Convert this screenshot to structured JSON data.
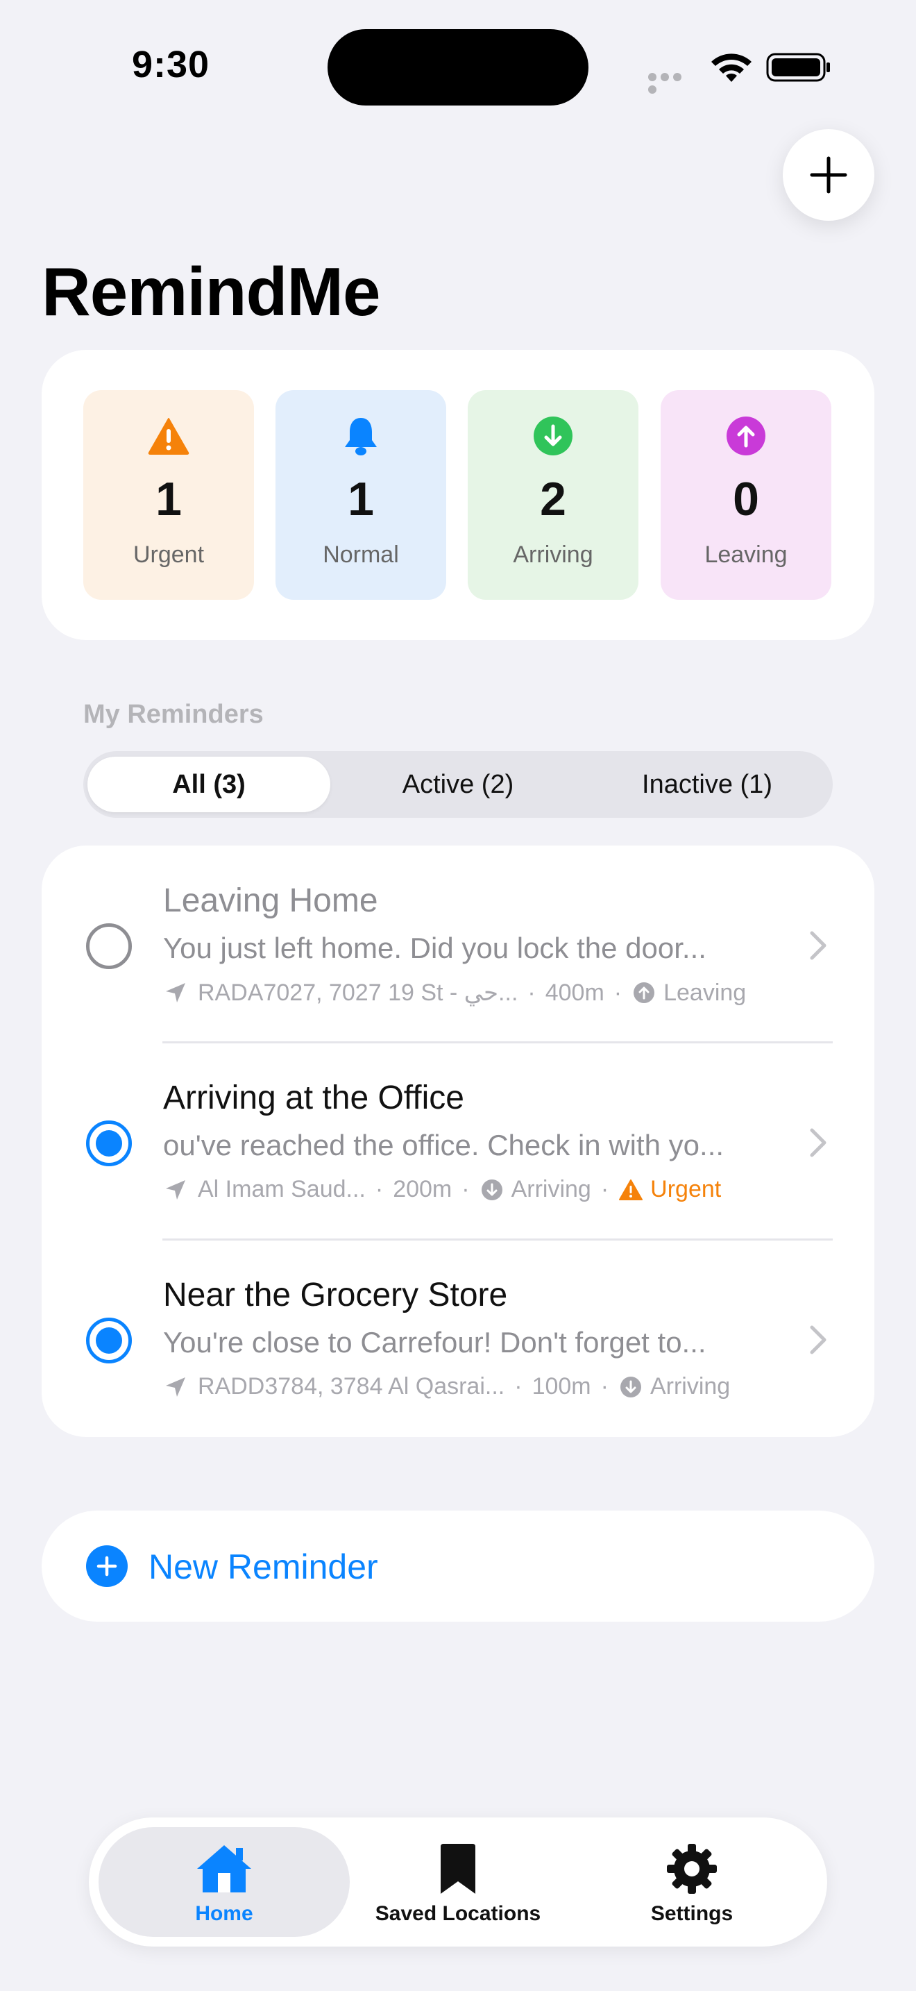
{
  "status_bar": {
    "time": "9:30"
  },
  "app": {
    "title": "RemindMe"
  },
  "stats": [
    {
      "key": "urgent",
      "count": "1",
      "label": "Urgent",
      "color": "#f5820a",
      "icon": "warning-icon"
    },
    {
      "key": "normal",
      "count": "1",
      "label": "Normal",
      "color": "#0a84ff",
      "icon": "bell-icon"
    },
    {
      "key": "arriving",
      "count": "2",
      "label": "Arriving",
      "color": "#30c45a",
      "icon": "arrow-down-circle-icon"
    },
    {
      "key": "leaving",
      "count": "0",
      "label": "Leaving",
      "color": "#c93ad8",
      "icon": "arrow-up-circle-icon"
    }
  ],
  "section": {
    "title": "My Reminders"
  },
  "filter_tabs": [
    {
      "label": "All (3)",
      "selected": true
    },
    {
      "label": "Active (2)",
      "selected": false
    },
    {
      "label": "Inactive (1)",
      "selected": false
    }
  ],
  "reminders": [
    {
      "title": "Leaving Home",
      "body": "You just left home. Did you lock the door...",
      "location": "RADA7027, 7027 19 St - حي...",
      "distance": "400m",
      "trigger": "Leaving",
      "active": false
    },
    {
      "title": "Arriving at the Office",
      "body": "ou've reached the office. Check in with yo...",
      "location": "Al Imam Saud...",
      "distance": "200m",
      "trigger": "Arriving",
      "priority": "Urgent",
      "active": true
    },
    {
      "title": "Near the Grocery Store",
      "body": "You're close to Carrefour! Don't forget to...",
      "location": "RADD3784, 3784 Al Qasrai...",
      "distance": "100m",
      "trigger": "Arriving",
      "active": true
    }
  ],
  "new_reminder": {
    "label": "New Reminder"
  },
  "tabbar": [
    {
      "label": "Home",
      "icon": "house-icon",
      "active": true
    },
    {
      "label": "Saved Locations",
      "icon": "bookmark-icon",
      "active": false
    },
    {
      "label": "Settings",
      "icon": "gear-icon",
      "active": false
    }
  ],
  "colors": {
    "accent": "#0a84ff",
    "background": "#f2f2f7",
    "urgent": "#f5820a"
  }
}
